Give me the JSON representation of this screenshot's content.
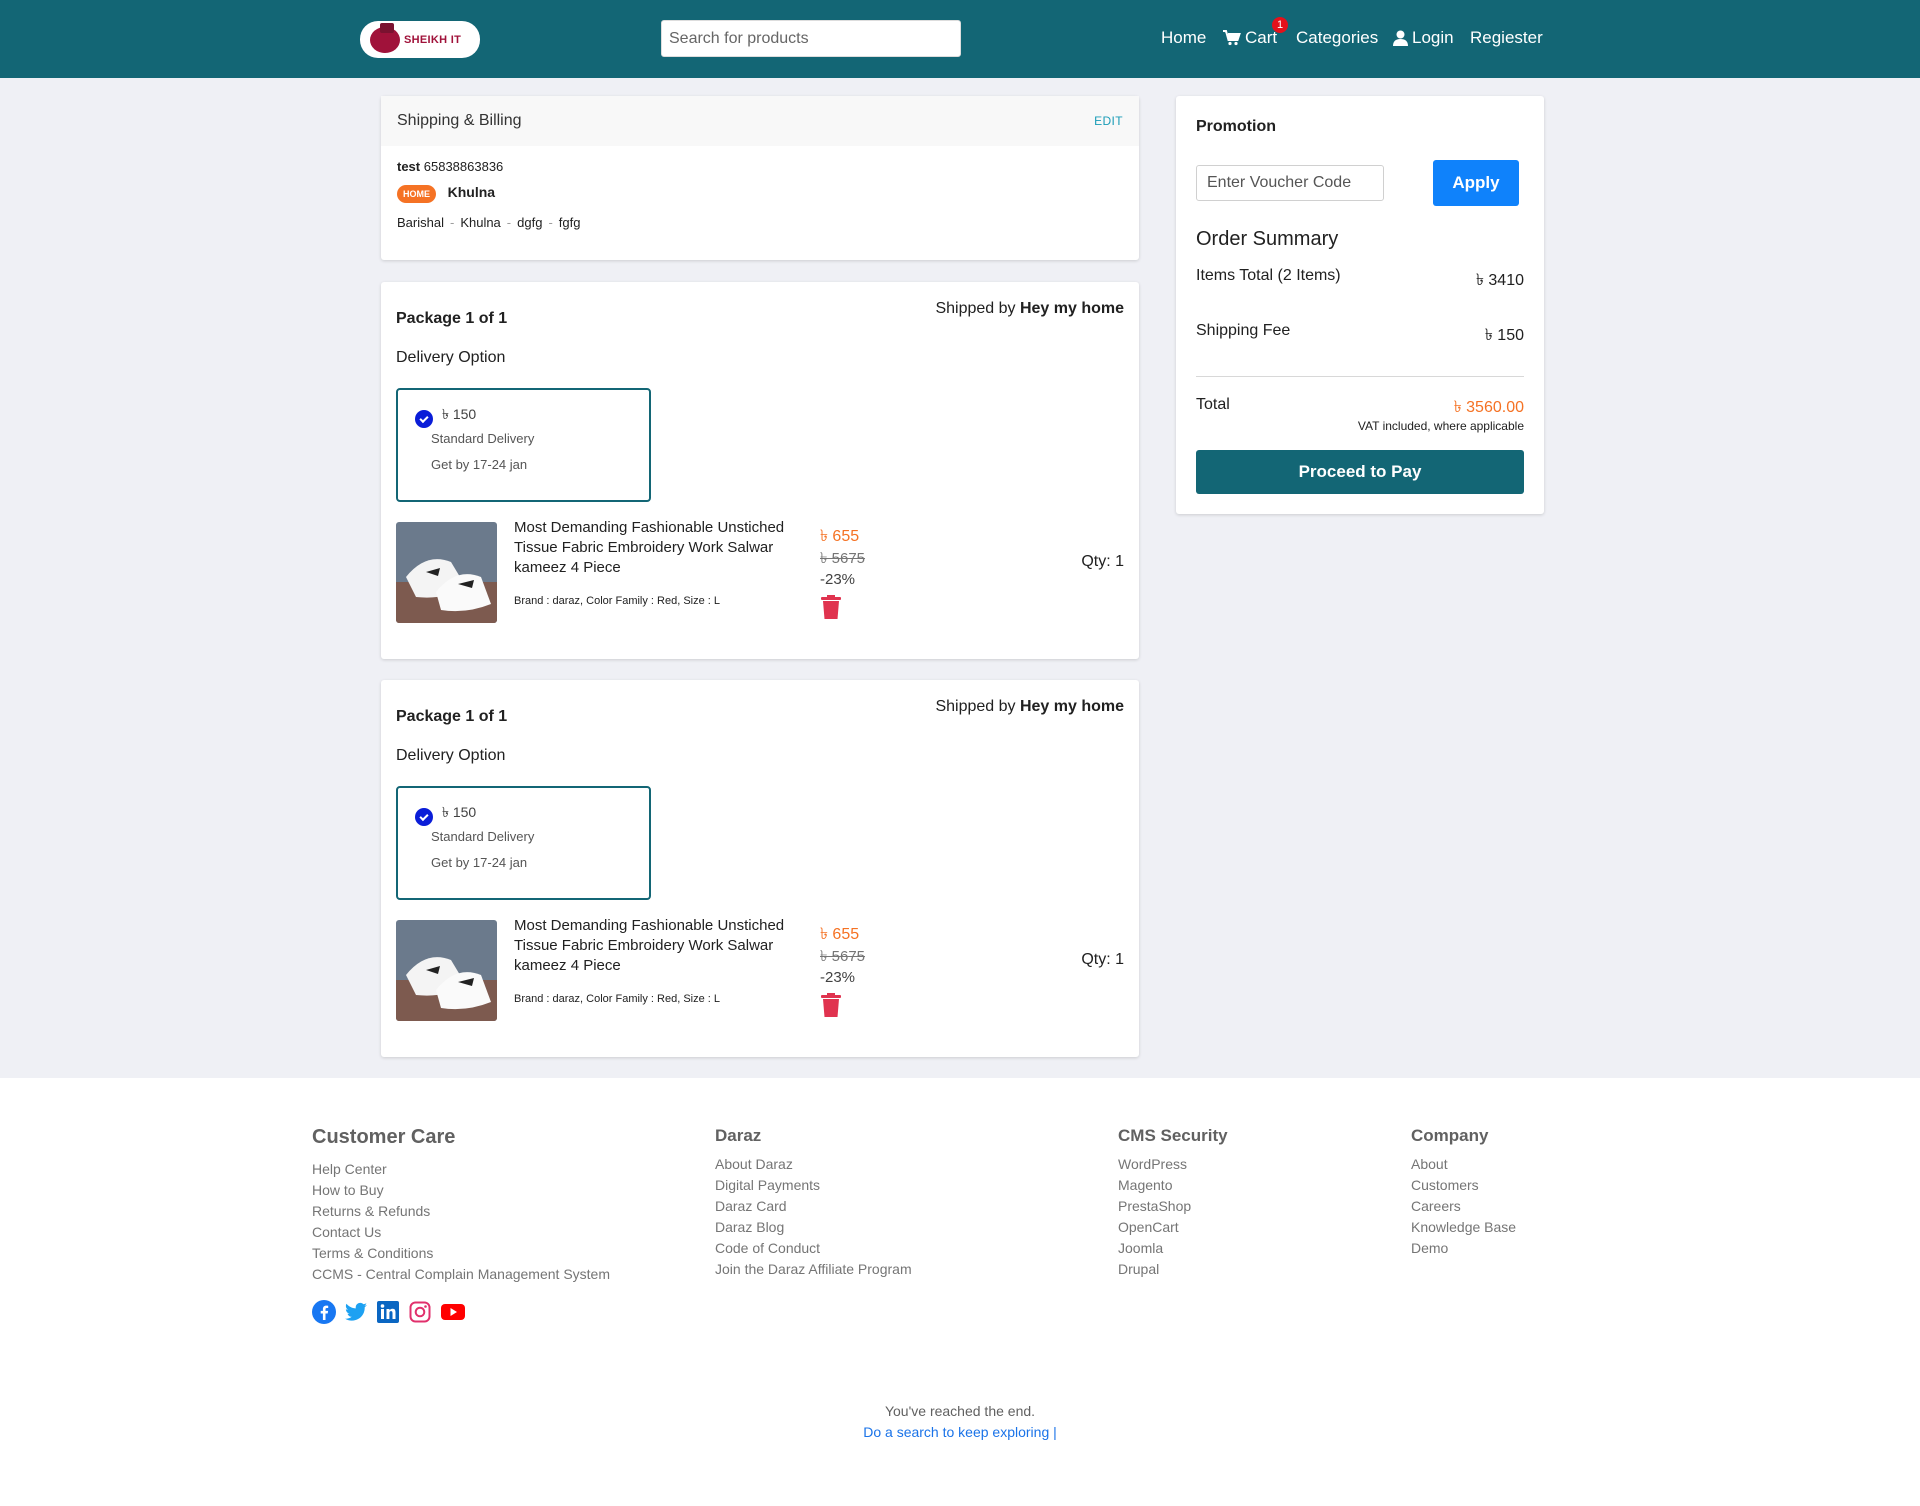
{
  "header": {
    "logo_text": "SHEIKH IT",
    "search_placeholder": "Search for products",
    "nav": {
      "home": "Home",
      "cart": "Cart",
      "cart_count": "1",
      "categories": "Categories",
      "login": "Login",
      "register": "Regiester"
    }
  },
  "shipping": {
    "title": "Shipping & Billing",
    "edit": "EDIT",
    "name": "test",
    "phone": "65838863836",
    "tag": "HOME",
    "city": "Khulna",
    "address": [
      "Barishal",
      "Khulna",
      "dgfg",
      "fgfg"
    ],
    "address_sep": "-"
  },
  "packages": [
    {
      "title": "Package 1 of 1",
      "shipped_prefix": "Shipped by",
      "shipped_by": "Hey my home",
      "delivery_label": "Delivery Option",
      "delivery": {
        "price": "৳ 150",
        "name": "Standard Delivery",
        "eta": "Get by 17-24 jan"
      },
      "product": {
        "title": "Most Demanding Fashionable Unstiched Tissue Fabric Embroidery Work Salwar kameez 4 Piece",
        "attrs": "Brand : daraz, Color Family : Red, Size : L",
        "price": "৳ 655",
        "old_price": "৳ 5675",
        "discount": "-23%",
        "qty": "Qty: 1"
      }
    },
    {
      "title": "Package 1 of 1",
      "shipped_prefix": "Shipped by",
      "shipped_by": "Hey my home",
      "delivery_label": "Delivery Option",
      "delivery": {
        "price": "৳ 150",
        "name": "Standard Delivery",
        "eta": "Get by 17-24 jan"
      },
      "product": {
        "title": "Most Demanding Fashionable Unstiched Tissue Fabric Embroidery Work Salwar kameez 4 Piece",
        "attrs": "Brand : daraz, Color Family : Red, Size : L",
        "price": "৳ 655",
        "old_price": "৳ 5675",
        "discount": "-23%",
        "qty": "Qty: 1"
      }
    }
  ],
  "summary": {
    "promo_title": "Promotion",
    "voucher_placeholder": "Enter Voucher Code",
    "apply": "Apply",
    "title": "Order Summary",
    "items_label": "Items Total (2 Items)",
    "items_value": "৳ 3410",
    "shipping_label": "Shipping Fee",
    "shipping_value": "৳ 150",
    "total_label": "Total",
    "total_value": "৳ 3560.00",
    "vat": "VAT included, where applicable",
    "proceed": "Proceed to Pay"
  },
  "footer": {
    "customer_care": {
      "title": "Customer Care",
      "links": [
        "Help Center",
        "How to Buy",
        "Returns & Refunds",
        "Contact Us",
        "Terms & Conditions",
        "CCMS - Central Complain Management System"
      ]
    },
    "daraz": {
      "title": "Daraz",
      "links": [
        "About Daraz",
        "Digital Payments",
        "Daraz Card",
        "Daraz Blog",
        "Code of Conduct",
        "Join the Daraz Affiliate Program"
      ]
    },
    "cms": {
      "title": "CMS Security",
      "links": [
        "WordPress",
        "Magento",
        "PrestaShop",
        "OpenCart",
        "Joomla",
        "Drupal"
      ]
    },
    "company": {
      "title": "Company",
      "links": [
        "About",
        "Customers",
        "Careers",
        "Knowledge Base",
        "Demo"
      ]
    },
    "socials": [
      "facebook-icon",
      "twitter-icon",
      "linkedin-icon",
      "instagram-icon",
      "youtube-icon"
    ],
    "end_text": "You've reached the end.",
    "end_link": "Do a search to keep exploring |"
  },
  "colors": {
    "brand": "#136675",
    "accent": "#f57224",
    "apply": "#0f82fb",
    "badge": "#e4111b"
  }
}
